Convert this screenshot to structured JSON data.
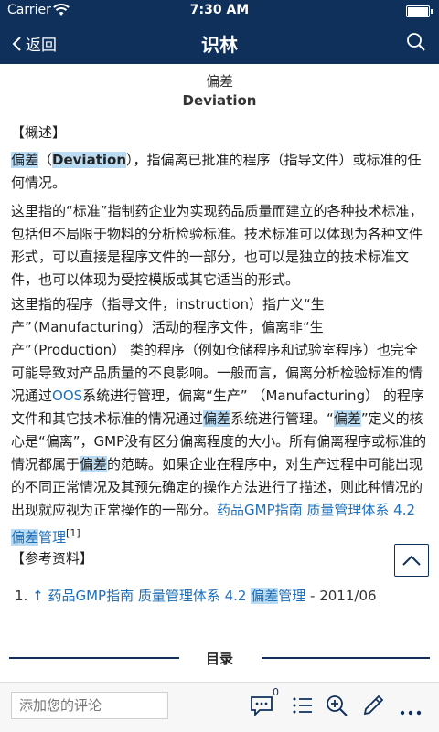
{
  "status": {
    "carrier": "Carrier",
    "time": "7:30 AM"
  },
  "nav": {
    "back_label": "返回",
    "title": "识林"
  },
  "article": {
    "title_cn": "偏差",
    "title_en": "Deviation",
    "overview_heading": "【概述】",
    "p1": {
      "term": "偏差",
      "open": "（",
      "term_en": "Deviation",
      "rest": "），指偏离已批准的程序（指导文件）或标准的任何情况。"
    },
    "p2": "这里指的“标准”指制药企业为实现药品质量而建立的各种技术标准，包括但不局限于物料的分析检验标准。技术标准可以体现为各种文件形式，可以直接是程序文件的一部分，也可以是独立的技术标准文件，也可以体现为受控模版或其它适当的形式。",
    "p3": {
      "s1": "这里指的程序（指导文件，instruction）指广义“生产”（Manufacturing）活动的程序文件，偏离非“生产”（Production） 类的程序（例如仓储程序和试验室程序）也完全可能导致对产品质量的不良影响。一般而言，偏离分析检验标准的情况通过",
      "oos": "OOS",
      "s2": "系统进行管理，偏离“生产” （Manufacturing） 的程序文件和其它技术标准的情况通过",
      "h1": "偏差",
      "s3": "系统进行管理。“",
      "h2": "偏差",
      "s4": "”定义的核心是“偏离”，GMP没有区分偏离程度的大小。所有偏离程序或标准的情况都属于",
      "h3": "偏差",
      "s5": "的范畴。如果企业在程序中，对生产过程中可能出现的不同正常情况及其预先确定的操作方法进行了描述，则此种情况的出现就应视为正常操作的一部分。",
      "link_a": "药品GMP指南 质量管理体系 4.2 ",
      "link_hl": "偏差",
      "link_b": "管理",
      "cite": "[1]"
    },
    "refs_heading": "【参考资料】",
    "ref1": {
      "num": "1.",
      "arrow": "↑",
      "link_a": "药品GMP指南 质量管理体系 4.2 ",
      "link_hl": "偏差",
      "link_b": "管理",
      "date": " - 2011/06"
    },
    "toc_label": "目录"
  },
  "bottom": {
    "comment_placeholder": "添加您的评论",
    "comment_count": "0"
  },
  "colors": {
    "navy": "#10305c",
    "link": "#1e6fb8",
    "highlight": "#b9dcf4"
  },
  "icons": [
    "wifi-icon",
    "battery-icon",
    "chevron-left-icon",
    "search-icon",
    "chevron-up-icon",
    "comment-icon",
    "list-icon",
    "zoom-in-icon",
    "pen-icon",
    "more-icon"
  ]
}
